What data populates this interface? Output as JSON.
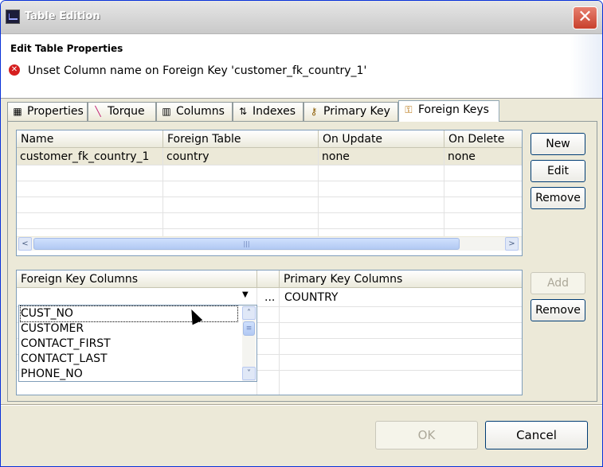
{
  "window": {
    "title": "Table Edition",
    "close_glyph": "✕",
    "icon": "eclipse-app-icon"
  },
  "header": {
    "title": "Edit Table Properties",
    "error_message": "Unset Column name on Foreign Key 'customer_fk_country_1'",
    "error_icon": "error-icon"
  },
  "tabs": [
    {
      "label": "Properties",
      "icon": "table-icon"
    },
    {
      "label": "Torque",
      "icon": "torque-icon"
    },
    {
      "label": "Columns",
      "icon": "columns-icon"
    },
    {
      "label": "Indexes",
      "icon": "indexes-icon"
    },
    {
      "label": "Primary Key",
      "icon": "key-icon"
    },
    {
      "label": "Foreign Keys",
      "icon": "foreign-key-icon",
      "active": true
    }
  ],
  "foreign_keys_table": {
    "columns": [
      "Name",
      "Foreign Table",
      "On Update",
      "On Delete"
    ],
    "rows": [
      [
        "customer_fk_country_1",
        "country",
        "none",
        "none"
      ]
    ]
  },
  "fk_buttons": {
    "new": "New",
    "edit": "Edit",
    "remove": "Remove"
  },
  "columns_table": {
    "left_header": "Foreign Key Columns",
    "right_header": "Primary Key Columns",
    "ellipsis": "...",
    "primary_value": "COUNTRY",
    "dropdown_options": [
      "CUST_NO",
      "CUSTOMER",
      "CONTACT_FIRST",
      "CONTACT_LAST",
      "PHONE_NO"
    ],
    "dropdown_arrow": "▼"
  },
  "col_buttons": {
    "add": "Add",
    "remove": "Remove"
  },
  "dialog_buttons": {
    "ok": "OK",
    "cancel": "Cancel"
  },
  "scroll_glyphs": {
    "left": "<",
    "right": ">",
    "up": "˄",
    "down": "˅",
    "grip": "|||",
    "grip_v": "≡"
  }
}
